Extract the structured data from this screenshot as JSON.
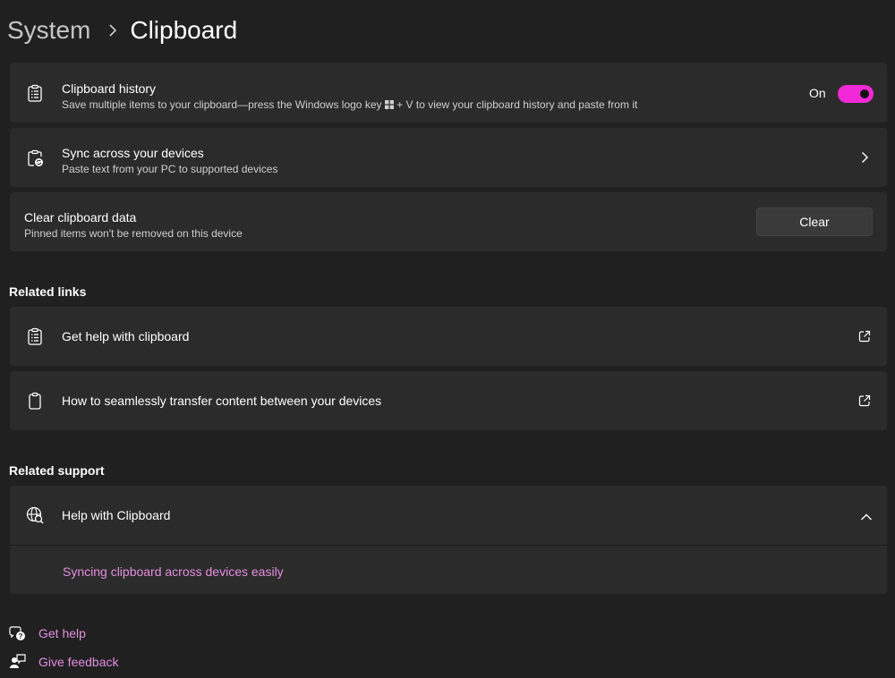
{
  "breadcrumb": {
    "parent": "System",
    "current": "Clipboard"
  },
  "history": {
    "title": "Clipboard history",
    "subtitle_before": "Save multiple items to your clipboard—press the Windows logo key",
    "subtitle_after": "+ V to view your clipboard history and paste from it",
    "toggle_label": "On",
    "toggle_on": true
  },
  "sync": {
    "title": "Sync across your devices",
    "subtitle": "Paste text from your PC to supported devices"
  },
  "clear_data": {
    "title": "Clear clipboard data",
    "subtitle": "Pinned items won't be removed on this device",
    "button_label": "Clear"
  },
  "related_links": {
    "header": "Related links",
    "items": [
      {
        "label": "Get help with clipboard"
      },
      {
        "label": "How to seamlessly transfer content between your devices"
      }
    ]
  },
  "related_support": {
    "header": "Related support",
    "item_title": "Help with Clipboard",
    "link": "Syncing clipboard across devices easily"
  },
  "footer": {
    "get_help": "Get help",
    "give_feedback": "Give feedback"
  },
  "colors": {
    "accent": "#f229d6",
    "link": "#e48ee0",
    "background": "#202020",
    "card": "#2b2b2b"
  }
}
